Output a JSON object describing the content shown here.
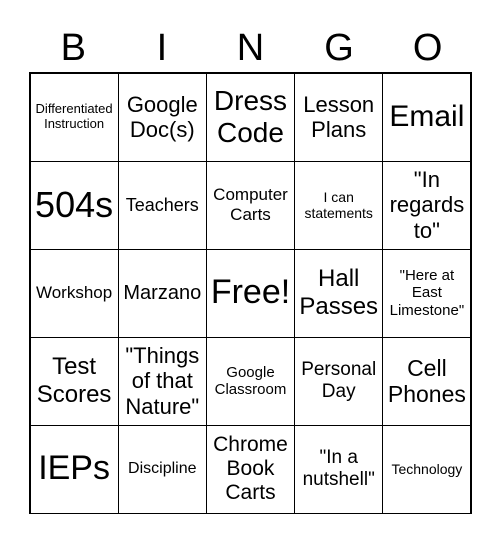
{
  "header": [
    "B",
    "I",
    "N",
    "G",
    "O"
  ],
  "cells": [
    "Differentiated\nInstruction",
    "Google\nDoc(s)",
    "Dress\nCode",
    "Lesson\nPlans",
    "Email",
    "504s",
    "Teachers",
    "Computer\nCarts",
    "I can\nstatements",
    "\"In\nregards\nto\"",
    "Workshop",
    "Marzano",
    "Free!",
    "Hall\nPasses",
    "\"Here at\nEast\nLimestone\"",
    "Test\nScores",
    "\"Things\nof that\nNature\"",
    "Google\nClassroom",
    "Personal\nDay",
    "Cell\nPhones",
    "IEPs",
    "Discipline",
    "Chrome\nBook\nCarts",
    "\"In a\nnutshell\"",
    "Technology"
  ]
}
